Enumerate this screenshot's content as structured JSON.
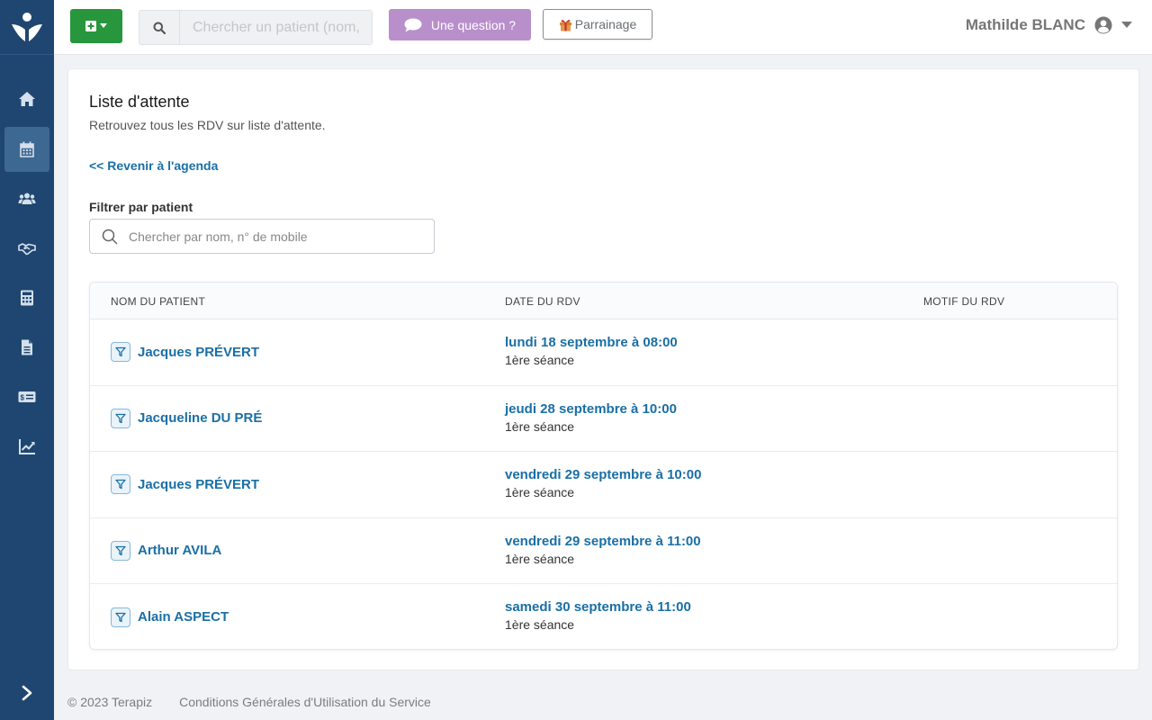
{
  "app": {
    "name": "Terapiz"
  },
  "topbar": {
    "search_placeholder": "Chercher un patient (nom, n° de mobile)",
    "question_label": "Une question ?",
    "parrainage_label": "Parrainage",
    "user_name": "Mathilde BLANC"
  },
  "sidebar": {
    "items": [
      {
        "name": "home-icon",
        "active": false
      },
      {
        "name": "calendar-icon",
        "active": true
      },
      {
        "name": "users-icon",
        "active": false
      },
      {
        "name": "handshake-icon",
        "active": false
      },
      {
        "name": "calculator-icon",
        "active": false
      },
      {
        "name": "document-icon",
        "active": false
      },
      {
        "name": "money-check-icon",
        "active": false
      },
      {
        "name": "chart-line-icon",
        "active": false
      }
    ]
  },
  "page": {
    "title": "Liste d'attente",
    "subtitle": "Retrouvez tous les RDV sur liste d'attente.",
    "back_link": "<< Revenir à l'agenda",
    "filter_label": "Filtrer par patient",
    "filter_placeholder": "Chercher par nom, n° de mobile"
  },
  "table": {
    "headers": [
      "NOM DU PATIENT",
      "DATE DU RDV",
      "MOTIF DU RDV"
    ],
    "rows": [
      {
        "patient": "Jacques PRÉVERT",
        "date": "lundi 18 septembre à 08:00",
        "type": "1ère séance",
        "motif": ""
      },
      {
        "patient": "Jacqueline DU PRÉ",
        "date": "jeudi 28 septembre à 10:00",
        "type": "1ère séance",
        "motif": ""
      },
      {
        "patient": "Jacques PRÉVERT",
        "date": "vendredi 29 septembre à 10:00",
        "type": "1ère séance",
        "motif": ""
      },
      {
        "patient": "Arthur AVILA",
        "date": "vendredi 29 septembre à 11:00",
        "type": "1ère séance",
        "motif": ""
      },
      {
        "patient": "Alain ASPECT",
        "date": "samedi 30 septembre à 11:00",
        "type": "1ère séance",
        "motif": ""
      }
    ]
  },
  "footer": {
    "copyright": "© 2023 Terapiz",
    "cgu": "Conditions Générales d'Utilisation du Service"
  },
  "colors": {
    "sidebar": "#1f4670",
    "primary_link": "#1a6fa6",
    "add_button": "#27963c",
    "question_button": "#b98fcb"
  }
}
